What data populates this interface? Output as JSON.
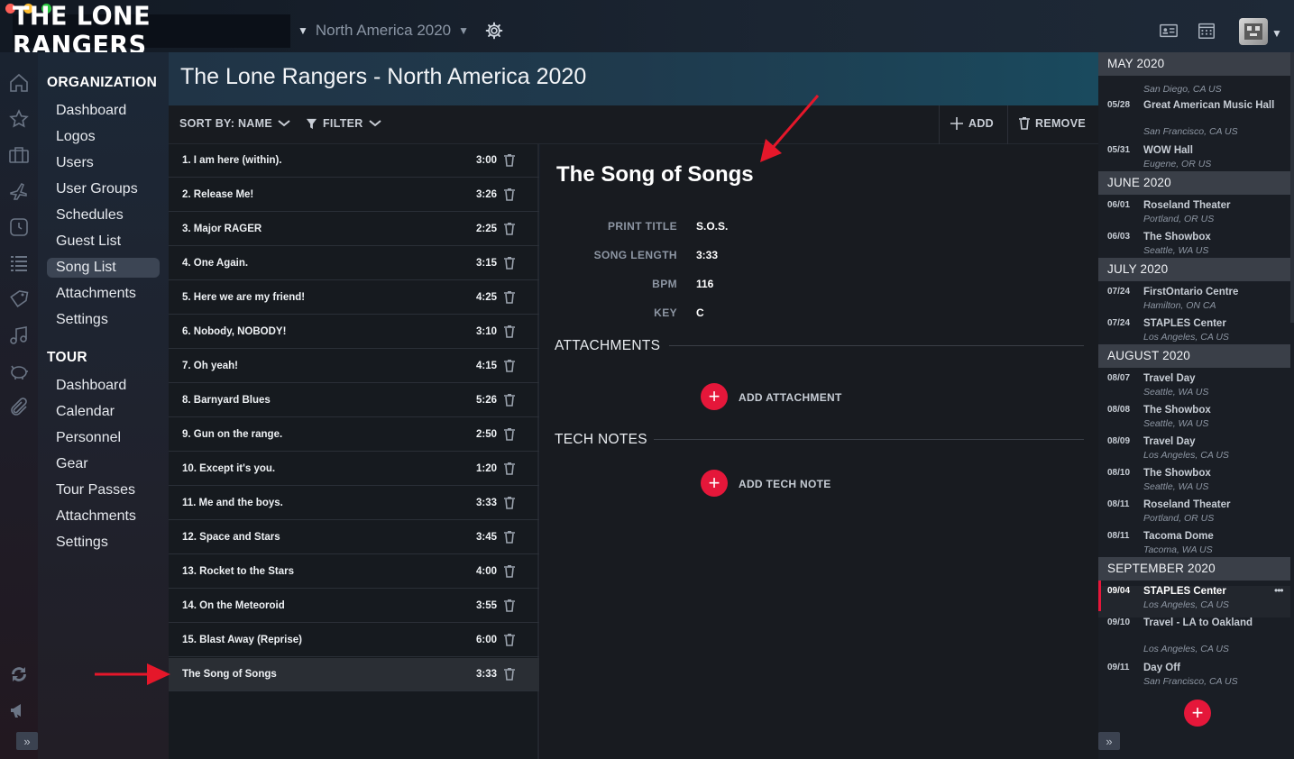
{
  "brand": {
    "logo_text": "THE LONE RANGERS"
  },
  "tour_selector": {
    "value": "North America 2020"
  },
  "colors": {
    "accent": "#e5173a",
    "panel": "#181b20",
    "nav_active": "#3c4554"
  },
  "top_icons": [
    "settings-gear-icon",
    "contact-card-icon",
    "calendar-icon",
    "user-avatar"
  ],
  "rail_icons": [
    "home-icon",
    "star-icon",
    "briefcase-icon",
    "plane-icon",
    "clock-icon",
    "list-icon",
    "tag-icon",
    "music-note-icon",
    "piggy-bank-icon",
    "paperclip-icon",
    "sync-icon",
    "megaphone-icon"
  ],
  "nav": {
    "organization_label": "ORGANIZATION",
    "organization_items": [
      "Dashboard",
      "Logos",
      "Users",
      "User Groups",
      "Schedules",
      "Guest List",
      "Song List",
      "Attachments",
      "Settings"
    ],
    "active_item": "Song List",
    "tour_label": "TOUR",
    "tour_items": [
      "Dashboard",
      "Calendar",
      "Personnel",
      "Gear",
      "Tour Passes",
      "Attachments",
      "Settings"
    ]
  },
  "header": {
    "title": "The Lone Rangers - North America 2020"
  },
  "toolbar": {
    "sort_label": "SORT BY: NAME",
    "filter_label": "FILTER",
    "add_label": "ADD",
    "remove_label": "REMOVE"
  },
  "songs": [
    {
      "title": "1. I am here (within).",
      "duration": "3:00"
    },
    {
      "title": "2. Release Me!",
      "duration": "3:26"
    },
    {
      "title": "3. Major RAGER",
      "duration": "2:25"
    },
    {
      "title": "4. One Again.",
      "duration": "3:15"
    },
    {
      "title": "5. Here we are my friend!",
      "duration": "4:25"
    },
    {
      "title": "6. Nobody, NOBODY!",
      "duration": "3:10"
    },
    {
      "title": "7. Oh yeah!",
      "duration": "4:15"
    },
    {
      "title": "8. Barnyard Blues",
      "duration": "5:26"
    },
    {
      "title": "9. Gun on the range.",
      "duration": "2:50"
    },
    {
      "title": "10. Except it's you.",
      "duration": "1:20"
    },
    {
      "title": "11. Me and the boys.",
      "duration": "3:33"
    },
    {
      "title": "12. Space and Stars",
      "duration": "3:45"
    },
    {
      "title": "13. Rocket to the Stars",
      "duration": "4:00"
    },
    {
      "title": "14. On the Meteoroid",
      "duration": "3:55"
    },
    {
      "title": "15. Blast Away (Reprise)",
      "duration": "6:00"
    },
    {
      "title": "The Song of Songs",
      "duration": "3:33"
    }
  ],
  "selected_song_index": 15,
  "detail": {
    "title": "The Song of Songs",
    "props": [
      {
        "label": "PRINT TITLE",
        "value": "S.O.S."
      },
      {
        "label": "SONG LENGTH",
        "value": "3:33"
      },
      {
        "label": "BPM",
        "value": "116"
      },
      {
        "label": "KEY",
        "value": "C"
      }
    ],
    "attachments_heading": "ATTACHMENTS",
    "add_attachment_label": "ADD ATTACHMENT",
    "tech_notes_heading": "TECH NOTES",
    "add_tech_note_label": "ADD TECH NOTE"
  },
  "schedule": [
    {
      "month": "MAY 2020",
      "events": [
        {
          "date": "",
          "venue": "",
          "location": "San Diego, CA US"
        },
        {
          "date": "05/28",
          "venue": "Great American Music Hall",
          "location": "San Francisco, CA US"
        },
        {
          "date": "05/31",
          "venue": "WOW Hall",
          "location": "Eugene, OR US"
        }
      ]
    },
    {
      "month": "JUNE 2020",
      "events": [
        {
          "date": "06/01",
          "venue": "Roseland Theater",
          "location": "Portland, OR US"
        },
        {
          "date": "06/03",
          "venue": "The Showbox",
          "location": "Seattle, WA US"
        }
      ]
    },
    {
      "month": "JULY 2020",
      "events": [
        {
          "date": "07/24",
          "venue": "FirstOntario Centre",
          "location": "Hamilton, ON CA"
        },
        {
          "date": "07/24",
          "venue": "STAPLES Center",
          "location": "Los Angeles, CA US"
        }
      ]
    },
    {
      "month": "AUGUST 2020",
      "events": [
        {
          "date": "08/07",
          "venue": "Travel Day",
          "location": "Seattle, WA US"
        },
        {
          "date": "08/08",
          "venue": "The Showbox",
          "location": "Seattle, WA US"
        },
        {
          "date": "08/09",
          "venue": "Travel Day",
          "location": "Los Angeles, CA US"
        },
        {
          "date": "08/10",
          "venue": "The Showbox",
          "location": "Seattle, WA US"
        },
        {
          "date": "08/11",
          "venue": "Roseland Theater",
          "location": "Portland, OR US"
        },
        {
          "date": "08/11",
          "venue": "Tacoma Dome",
          "location": "Tacoma, WA US"
        }
      ]
    },
    {
      "month": "SEPTEMBER 2020",
      "events": [
        {
          "date": "09/04",
          "venue": "STAPLES Center",
          "location": "Los Angeles, CA US",
          "selected": true,
          "more": "•••"
        },
        {
          "date": "09/10",
          "venue": "Travel - LA to Oakland",
          "location": "Los Angeles, CA US"
        },
        {
          "date": "09/11",
          "venue": "Day Off",
          "location": "San Francisco, CA US"
        }
      ]
    }
  ]
}
